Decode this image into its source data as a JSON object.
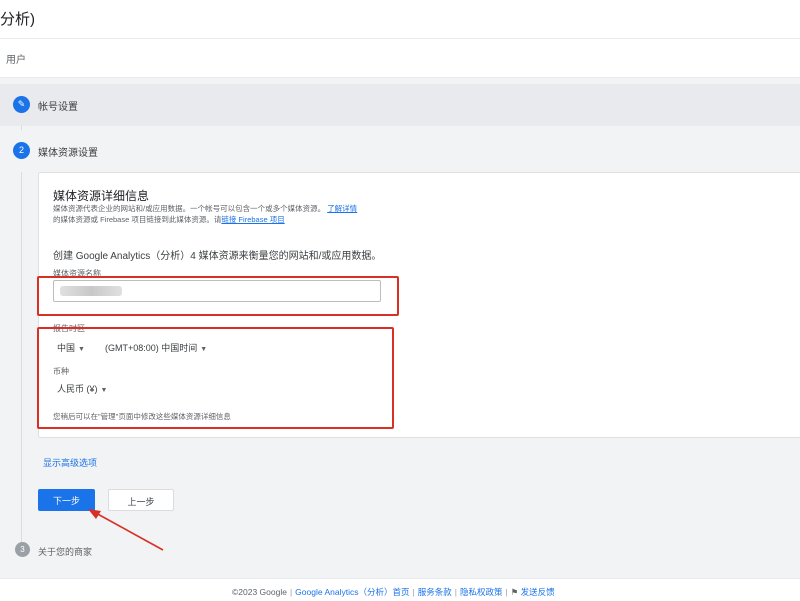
{
  "header": {
    "title": "分析)"
  },
  "breadcrumb": {
    "label": "用户"
  },
  "steps": [
    {
      "number": "✎",
      "title": "帐号设置"
    },
    {
      "number": "2",
      "title": "媒体资源设置"
    },
    {
      "number": "3",
      "title": "关于您的商家"
    }
  ],
  "card": {
    "title": "媒体资源详细信息",
    "desc": "媒体资源代表企业的网站和/或应用数据。一个帐号可以包含一个或多个媒体资源。",
    "desc_link": "了解详情",
    "desc2": "的媒体资源或 Firebase 项目链接到此媒体资源。请",
    "desc2_link": "链接 Firebase 项目",
    "create_text": "创建 Google Analytics（分析）4 媒体资源来衡量您的网站和/或应用数据。",
    "name_label": "媒体资源名称",
    "name_value": "",
    "tz_label": "报告时区",
    "country": "中国",
    "timezone": "(GMT+08:00) 中国时间",
    "currency_label": "币种",
    "currency": "人民币 (¥)",
    "note": "您稍后可以在\"管理\"页面中修改这些媒体资源详细信息"
  },
  "advanced_link": "显示高级选项",
  "buttons": {
    "next": "下一步",
    "prev": "上一步"
  },
  "footer": {
    "copyright": "©2023 Google",
    "product": "Google Analytics（分析）首页",
    "terms": "服务条款",
    "privacy": "隐私权政策",
    "feedback": "发送反馈"
  },
  "colors": {
    "accent": "#1a73e8",
    "highlight": "#d93025"
  }
}
